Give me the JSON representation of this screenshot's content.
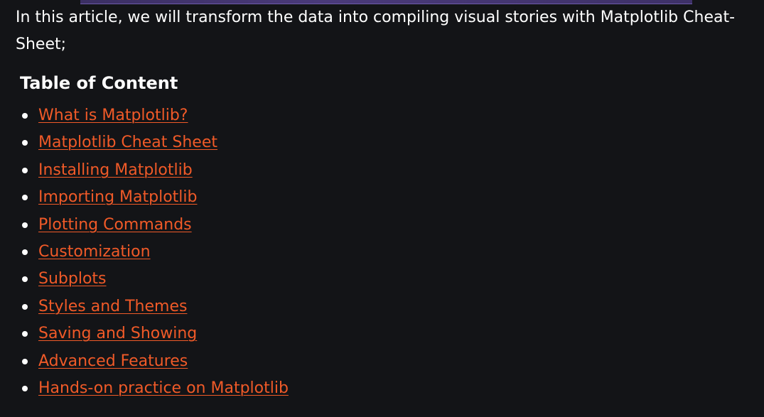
{
  "intro": {
    "text": "In this article, we will transform the data into compiling visual stories with Matplotlib Cheat-Sheet;"
  },
  "toc": {
    "heading": "Table of Content",
    "items": [
      {
        "label": "What is Matplotlib?"
      },
      {
        "label": "Matplotlib Cheat Sheet"
      },
      {
        "label": "Installing Matplotlib"
      },
      {
        "label": "Importing Matplotlib"
      },
      {
        "label": "Plotting Commands"
      },
      {
        "label": "Customization"
      },
      {
        "label": "Subplots"
      },
      {
        "label": "Styles and Themes"
      },
      {
        "label": "Saving and Showing"
      },
      {
        "label": "Advanced Features"
      },
      {
        "label": "Hands-on practice on Matplotlib"
      }
    ]
  },
  "colors": {
    "background": "#131417",
    "text": "#ffffff",
    "link": "#f05a28"
  }
}
